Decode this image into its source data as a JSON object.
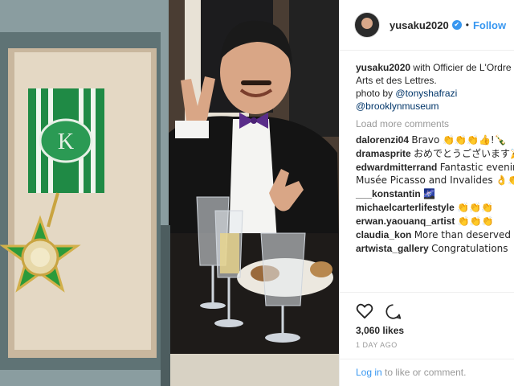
{
  "post": {
    "username": "yusaku2020",
    "separator": "•",
    "follow_label": "Follow",
    "verified_icon": "✔",
    "caption": {
      "user": "yusaku2020",
      "text": "with Officier de L'Ordre des Arts et des Lettres.",
      "photo_by": "photo by",
      "mention1": "@tonyshafrazi",
      "mention2": "@brooklynmuseum"
    },
    "load_more": "Load more comments",
    "comments": [
      {
        "user": "dalorenzi04",
        "text": "Bravo 👏👏👏👍!🍾"
      },
      {
        "user": "dramasprite",
        "text": "おめでとうございます🎉🍾"
      },
      {
        "user": "edwardmitterrand",
        "text": "Fantastic evening at Musée Picasso and Invalides 👌👏🌈"
      },
      {
        "user": "___konstantin",
        "text": "🌌"
      },
      {
        "user": "michaelcarterlifestyle",
        "text": "👏👏👏"
      },
      {
        "user": "erwan.yaouanq_artist",
        "text": "👏👏👏"
      },
      {
        "user": "claudia_kon",
        "text": "More than deserved 👏👏👏"
      },
      {
        "user": "artwista_gallery",
        "text": "Congratulations 🎖🎖"
      }
    ],
    "likes": "3,060 likes",
    "time_ago": "1 DAY AGO",
    "login_link": "Log in",
    "login_text": "to like or comment."
  }
}
